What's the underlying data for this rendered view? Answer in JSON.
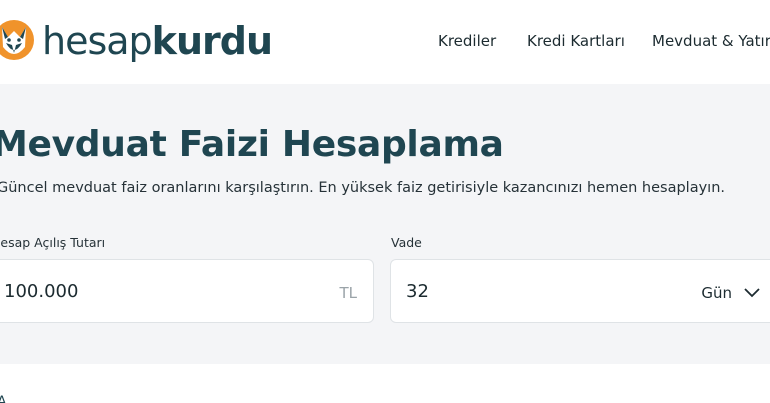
{
  "brand": {
    "logo_part1": "hesap",
    "logo_part2": "kurdu",
    "logo_icon": "wolf-logo-icon",
    "colors": {
      "accent": "#f0932b",
      "primary": "#1f4651"
    }
  },
  "nav": {
    "items": [
      {
        "label": "Krediler"
      },
      {
        "label": "Kredi Kartları"
      },
      {
        "label": "Mevduat & Yatırım"
      }
    ]
  },
  "hero": {
    "title": "Mevduat Faizi Hesaplama",
    "subtitle": "Güncel mevduat faiz oranlarını karşılaştırın. En yüksek faiz getirisiyle kazancınızı hemen hesaplayın."
  },
  "form": {
    "amount": {
      "label": "Hesap Açılış Tutarı",
      "value": "100.000",
      "suffix": "TL"
    },
    "term": {
      "label": "Vade",
      "value": "32",
      "unit": "Gün",
      "unit_icon": "chevron-down-icon"
    }
  },
  "footer_mark": "A"
}
